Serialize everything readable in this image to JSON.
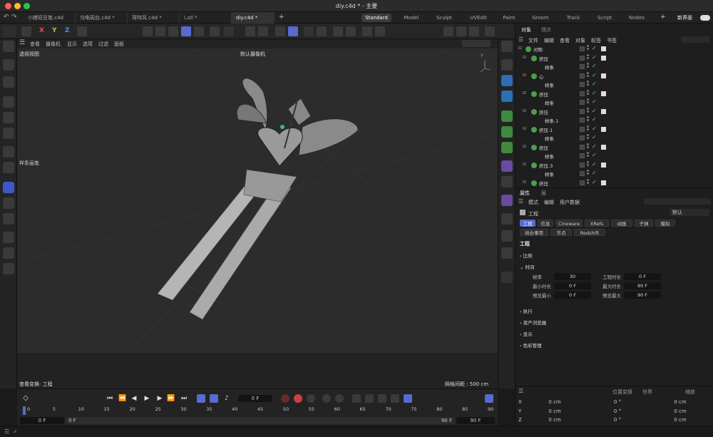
{
  "window": {
    "title": "diy.c4d * - 主要"
  },
  "tabs": [
    {
      "label": "小猪班豆笔.c4d",
      "active": false
    },
    {
      "label": "乌龟砚台.c4d *",
      "active": false
    },
    {
      "label": "哥特风.c4d *",
      "active": false
    },
    {
      "label": "\\.stl *",
      "active": false
    },
    {
      "label": "diy.c4d *",
      "active": true
    }
  ],
  "layouts": [
    "Standard",
    "Model",
    "Sculpt",
    "UVEdit",
    "Paint",
    "Groom",
    "Track",
    "Script",
    "Nodes"
  ],
  "layouts_active": "Standard",
  "new_interface": "新界面",
  "toolbar": {
    "x": "X",
    "y": "Y",
    "z": "Z"
  },
  "viewport": {
    "menu": [
      "查看",
      "摄像机",
      "显示",
      "选项",
      "过滤",
      "面板"
    ],
    "view_name": "透视视图",
    "camera": "默认摄像机",
    "tool_name": "样条画笔",
    "bottom_left": "查看变换: 工程",
    "grid_spacing": "网格间距 : 500 cm"
  },
  "object_panel": {
    "tabs": [
      "对象",
      "场次"
    ],
    "menu": [
      "文件",
      "编辑",
      "查看",
      "对象",
      "标签",
      "书签"
    ],
    "rows": [
      {
        "indent": 0,
        "name": "对称"
      },
      {
        "indent": 1,
        "name": "挤压"
      },
      {
        "indent": 2,
        "name": "样条"
      },
      {
        "indent": 1,
        "name": "心"
      },
      {
        "indent": 2,
        "name": "样条"
      },
      {
        "indent": 1,
        "name": "挤压"
      },
      {
        "indent": 2,
        "name": "样条"
      },
      {
        "indent": 1,
        "name": "挤压"
      },
      {
        "indent": 2,
        "name": "样条.1"
      },
      {
        "indent": 1,
        "name": "挤压.1"
      },
      {
        "indent": 2,
        "name": "样条"
      },
      {
        "indent": 1,
        "name": "挤压"
      },
      {
        "indent": 2,
        "name": "样条"
      },
      {
        "indent": 1,
        "name": "挤压.3"
      },
      {
        "indent": 2,
        "name": "样条"
      },
      {
        "indent": 1,
        "name": "挤压"
      }
    ]
  },
  "attr_panel": {
    "tabs": [
      "属性",
      "层"
    ],
    "menu": [
      "模式",
      "编辑",
      "用户数据"
    ],
    "object": "工程",
    "preset": "默认",
    "pills_row1": [
      "工程",
      "信息",
      "Cineware",
      "XRefs",
      "动画",
      "子弹",
      "模拟"
    ],
    "pills_row2": [
      "待办事项",
      "节点",
      "Redshift"
    ],
    "section_title": "工程",
    "groups": [
      "比例",
      "时间",
      "执行",
      "资产浏览器",
      "显示",
      "色彩管理"
    ],
    "time_fields": [
      {
        "label": "帧率",
        "value": "30",
        "label2": "工程时长",
        "value2": "0 F"
      },
      {
        "label": "最小时长",
        "value": "0 F",
        "label2": "最大时长",
        "value2": "90 F"
      },
      {
        "label": "预览最小",
        "value": "0 F",
        "label2": "预览最大",
        "value2": "90 F"
      }
    ]
  },
  "timeline": {
    "current_frame": "0 F",
    "ticks": [
      "0",
      "5",
      "10",
      "15",
      "20",
      "25",
      "30",
      "35",
      "40",
      "45",
      "50",
      "55",
      "60",
      "65",
      "70",
      "75",
      "80",
      "85",
      "90"
    ],
    "start": "0 F",
    "start2": "0 F",
    "end": "90 F",
    "end2": "90 F"
  },
  "coords": {
    "headers": [
      "位置变换",
      "世界",
      "缩放"
    ],
    "rows": [
      {
        "axis": "X",
        "pos": "0 cm",
        "rot": "0 °",
        "scale": "0 cm"
      },
      {
        "axis": "Y",
        "pos": "0 cm",
        "rot": "0 °",
        "scale": "0 cm"
      },
      {
        "axis": "Z",
        "pos": "0 cm",
        "rot": "0 °",
        "scale": "0 cm"
      }
    ]
  },
  "colors": {
    "accent": "#5a6ad0",
    "x": "#e05050",
    "y": "#9ad040",
    "z": "#5090e0"
  }
}
